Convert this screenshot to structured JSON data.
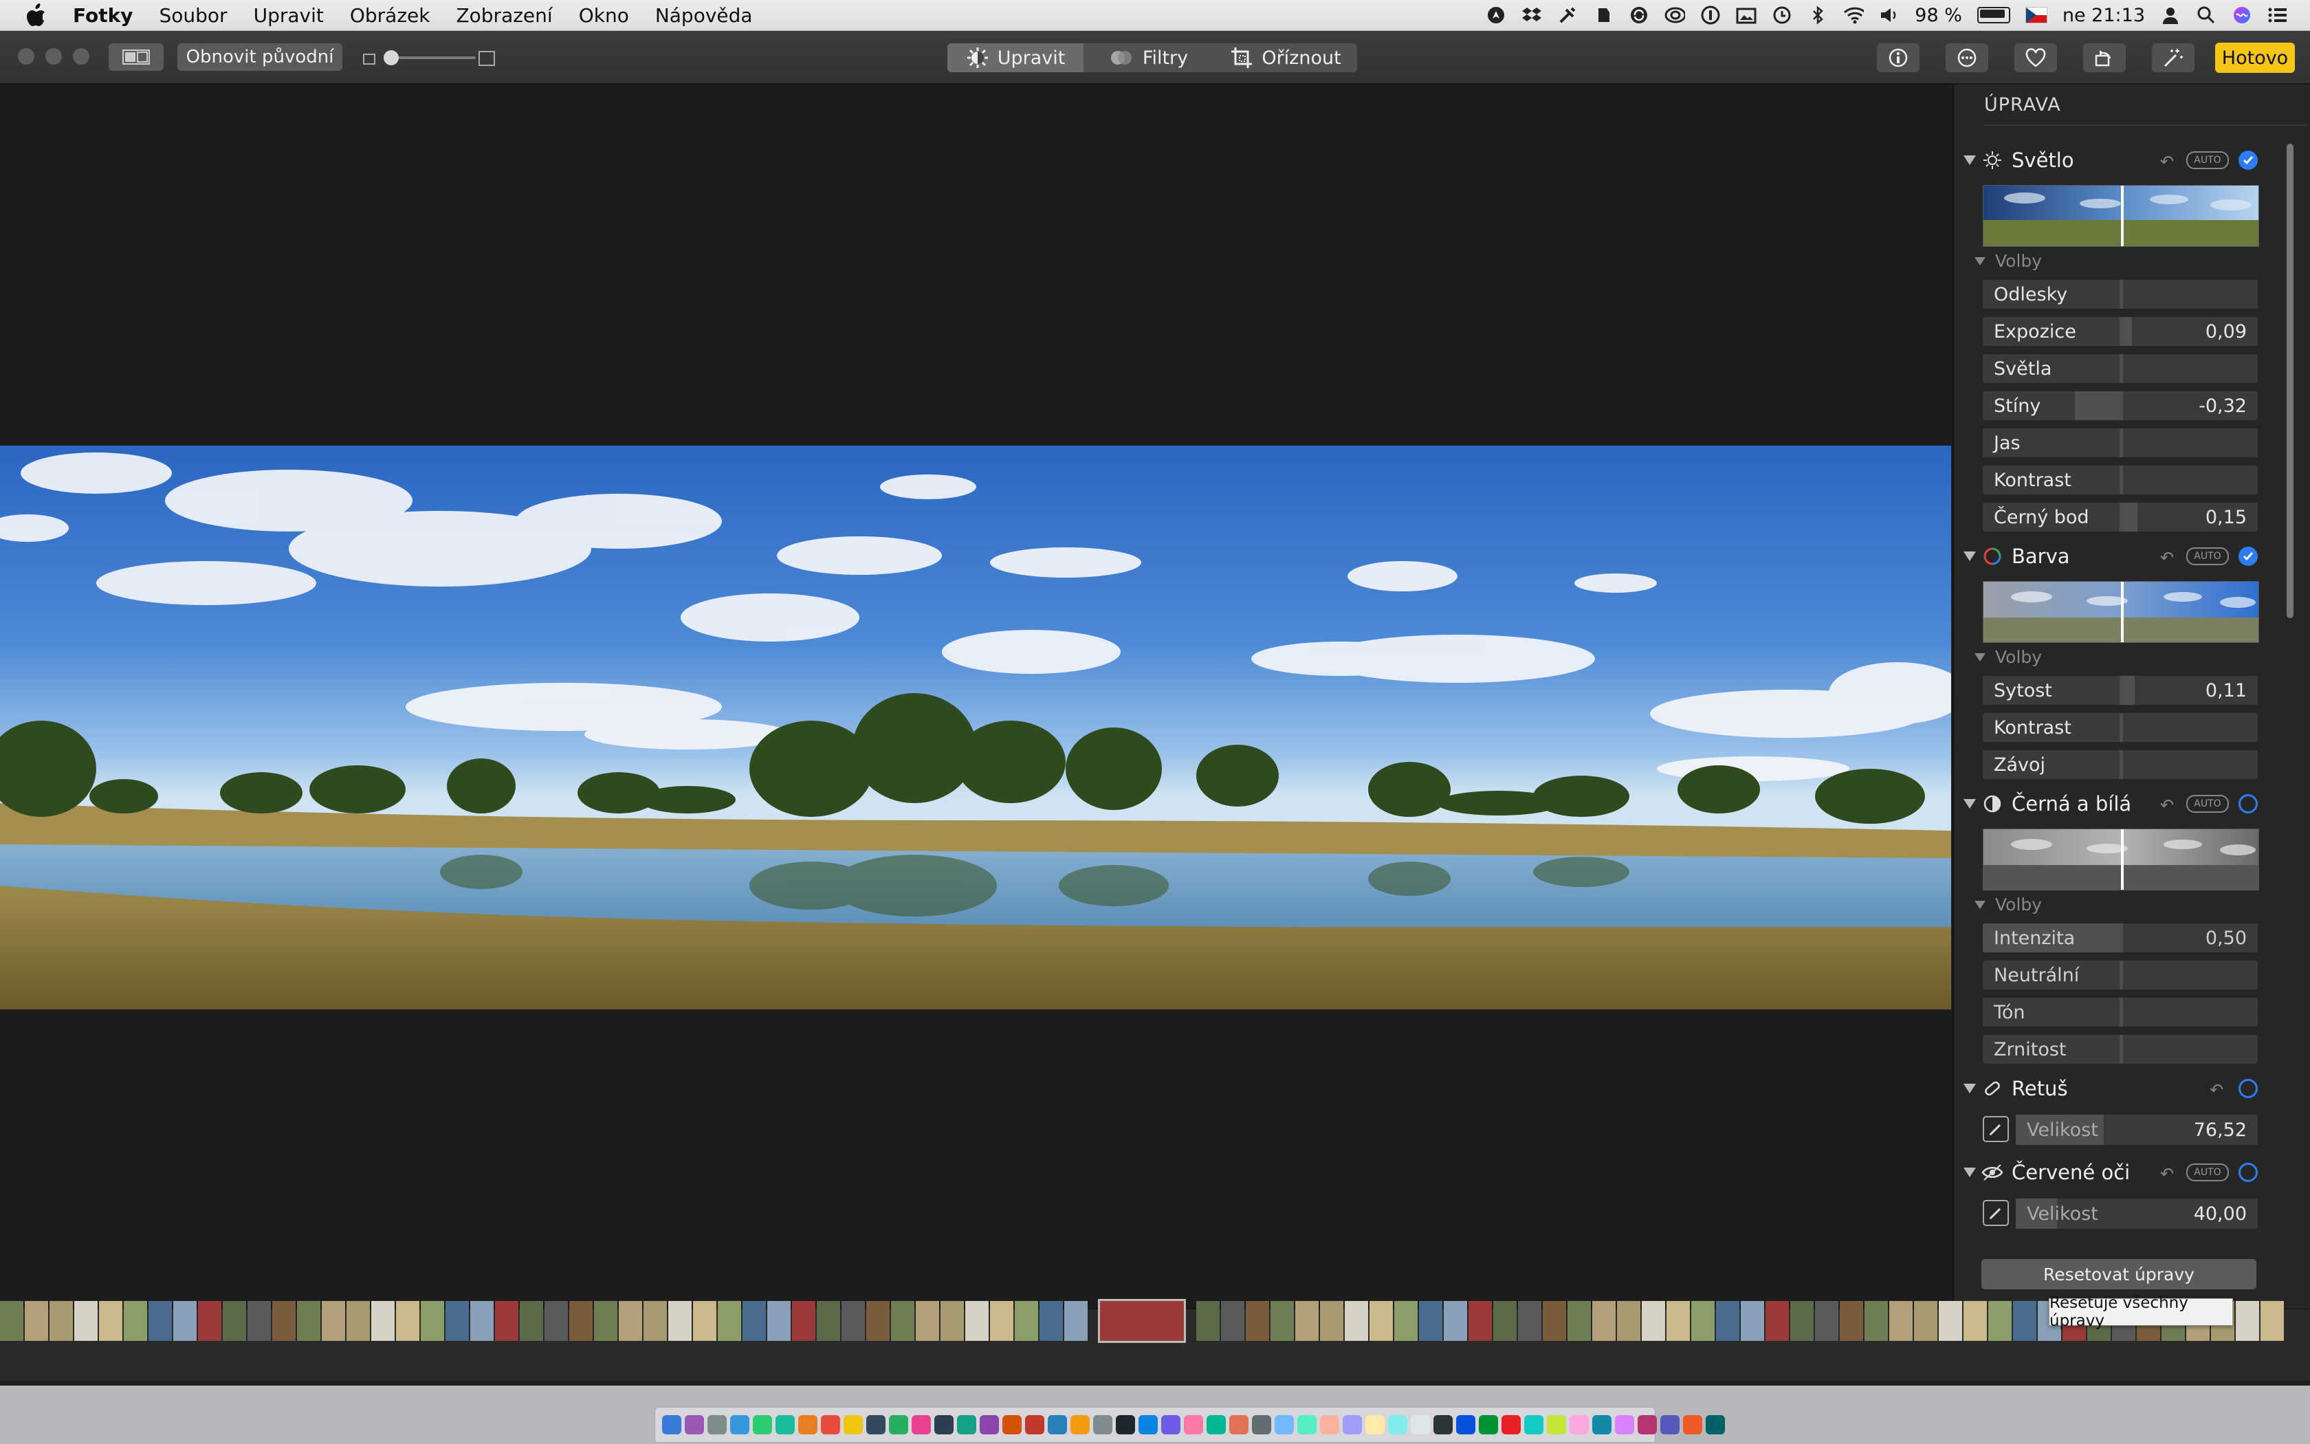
{
  "menubar": {
    "app_name": "Fotky",
    "items": [
      "Soubor",
      "Upravit",
      "Obrázek",
      "Zobrazení",
      "Okno",
      "Nápověda"
    ],
    "battery": "98 %",
    "clock": "ne 21:13"
  },
  "toolbar": {
    "revert_label": "Obnovit původní",
    "tabs": [
      {
        "label": "Upravit",
        "icon": "sun-dial-icon",
        "active": true
      },
      {
        "label": "Filtry",
        "icon": "filters-icon",
        "active": false
      },
      {
        "label": "Oříznout",
        "icon": "crop-icon",
        "active": false
      }
    ],
    "right_icons": [
      "info-icon",
      "more-icon",
      "heart-icon",
      "rotate-icon",
      "magic-wand-icon"
    ],
    "done_label": "Hotovo"
  },
  "panel": {
    "title": "ÚPRAVA",
    "options_label": "Volby",
    "auto_label": "AUTO",
    "light": {
      "label": "Světlo",
      "enabled": true,
      "sliders": [
        {
          "name": "Odlesky",
          "value": ""
        },
        {
          "name": "Expozice",
          "value": "0,09"
        },
        {
          "name": "Světla",
          "value": ""
        },
        {
          "name": "Stíny",
          "value": "-0,32"
        },
        {
          "name": "Jas",
          "value": ""
        },
        {
          "name": "Kontrast",
          "value": ""
        },
        {
          "name": "Černý bod",
          "value": "0,15"
        }
      ]
    },
    "color": {
      "label": "Barva",
      "enabled": true,
      "sliders": [
        {
          "name": "Sytost",
          "value": "0,11"
        },
        {
          "name": "Kontrast",
          "value": ""
        },
        {
          "name": "Závoj",
          "value": ""
        }
      ]
    },
    "bw": {
      "label": "Černá a bílá",
      "enabled": false,
      "sliders": [
        {
          "name": "Intenzita",
          "value": "0,50"
        },
        {
          "name": "Neutrální",
          "value": ""
        },
        {
          "name": "Tón",
          "value": ""
        },
        {
          "name": "Zrnitost",
          "value": ""
        }
      ]
    },
    "retouch": {
      "label": "Retuš",
      "size_label": "Velikost",
      "size_value": "76,52"
    },
    "redeye": {
      "label": "Červené oči",
      "size_label": "Velikost",
      "size_value": "40,00"
    },
    "reset_label": "Resetovat úpravy",
    "tooltip": "Resetuje všechny úpravy"
  },
  "colors": {
    "accent": "#2d7cf6",
    "done": "#f5c518",
    "sky_top": "#2f6fc9",
    "sky_bottom": "#bcd9f2",
    "grass": "#b89a55",
    "water": "#6f9fc4",
    "trees": "#2f4a1e"
  }
}
